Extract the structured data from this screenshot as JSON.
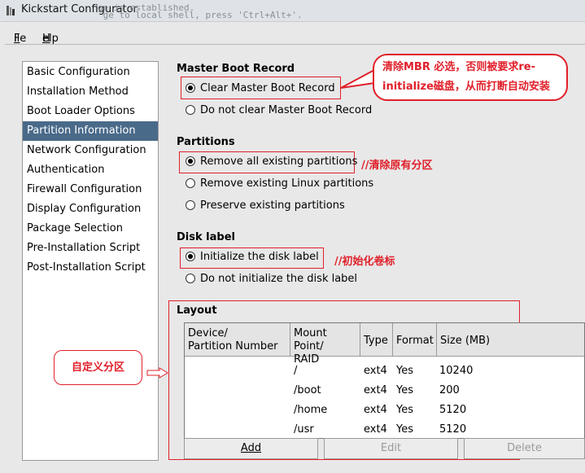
{
  "window": {
    "title": "Kickstart Configurator",
    "background_text": "ge is established.\n ge to local shell, press 'Ctrl+Alt+'."
  },
  "menu": {
    "file": "File",
    "help": "Help"
  },
  "sidebar": {
    "items": [
      {
        "label": "Basic Configuration",
        "selected": false
      },
      {
        "label": "Installation Method",
        "selected": false
      },
      {
        "label": "Boot Loader Options",
        "selected": false
      },
      {
        "label": "Partition Information",
        "selected": true
      },
      {
        "label": "Network Configuration",
        "selected": false
      },
      {
        "label": "Authentication",
        "selected": false
      },
      {
        "label": "Firewall Configuration",
        "selected": false
      },
      {
        "label": "Display Configuration",
        "selected": false
      },
      {
        "label": "Package Selection",
        "selected": false
      },
      {
        "label": "Pre-Installation Script",
        "selected": false
      },
      {
        "label": "Post-Installation Script",
        "selected": false
      }
    ]
  },
  "mbr": {
    "title": "Master Boot Record",
    "clear": "Clear Master Boot Record",
    "not_clear": "Do not clear Master Boot Record"
  },
  "partitions": {
    "title": "Partitions",
    "remove_all": "Remove all existing partitions",
    "remove_linux": "Remove existing Linux partitions",
    "preserve": "Preserve existing partitions"
  },
  "disk_label": {
    "title": "Disk label",
    "init": "Initialize the disk label",
    "no_init": "Do not initialize the disk label"
  },
  "layout": {
    "title": "Layout",
    "columns": {
      "device_line1": "Device/",
      "device_line2": "Partition Number",
      "mount_line1": "Mount Point/",
      "mount_line2": "RAID",
      "type": "Type",
      "format": "Format",
      "size": "Size (MB)"
    },
    "rows": [
      {
        "device": "",
        "mount": "/",
        "type": "ext4",
        "format": "Yes",
        "size": "10240"
      },
      {
        "device": "",
        "mount": "/boot",
        "type": "ext4",
        "format": "Yes",
        "size": "200"
      },
      {
        "device": "",
        "mount": "/home",
        "type": "ext4",
        "format": "Yes",
        "size": "5120"
      },
      {
        "device": "",
        "mount": "/usr",
        "type": "ext4",
        "format": "Yes",
        "size": "5120"
      }
    ],
    "add": "Add",
    "edit": "Edit",
    "delete": "Delete"
  },
  "annotations": {
    "mbr_note_line1": "清除MBR 必选，否则被要求re-",
    "mbr_note_line2": "initialize磁盘，从而打断自动安装",
    "partitions_note": "//清除原有分区",
    "disk_label_note": "//初始化卷标",
    "custom_partition": "自定义分区"
  },
  "colors": {
    "annotation_red": "#e0202a",
    "sidebar_selected": "#4a6a8a"
  }
}
